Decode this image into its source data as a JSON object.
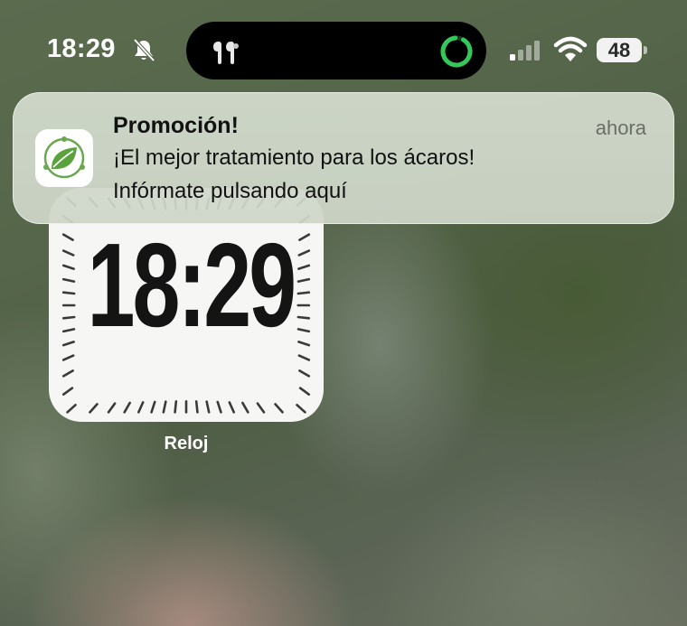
{
  "status_bar": {
    "time": "18:29",
    "battery_level": "48",
    "icons": [
      "bell-slash-icon",
      "airpods-icon",
      "timer-ring-icon",
      "cellular-signal-icon",
      "wifi-icon",
      "battery-icon"
    ]
  },
  "notification": {
    "title": "Promoción!",
    "time": "ahora",
    "line1": "¡El mejor tratamiento para los ácaros!",
    "line2": "Infórmate pulsando aquí",
    "app_icon": "leaf-icon",
    "accent": "#6aa84f"
  },
  "clock_widget": {
    "time": "18:29",
    "label": "Reloj"
  },
  "colors": {
    "timer_ring": "#34c759",
    "widget_bg": "#f6f6f4"
  }
}
